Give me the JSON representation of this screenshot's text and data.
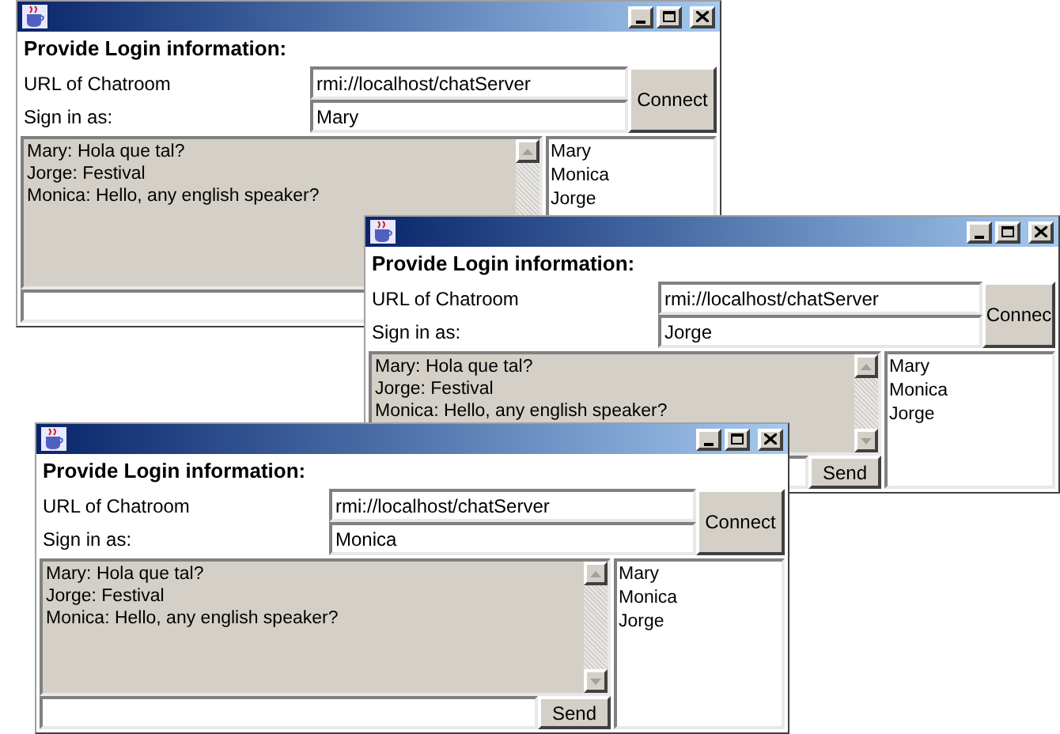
{
  "windows": [
    {
      "heading": "Provide Login information:",
      "url_label": "URL of Chatroom",
      "url_value": "rmi://localhost/chatServer",
      "name_label": "Sign in as:",
      "name_value": "Mary",
      "connect_label": "Connect",
      "messages": [
        "Mary: Hola que tal?",
        "Jorge: Festival",
        "Monica: Hello, any english speaker?"
      ],
      "users": [
        "Mary",
        "Monica",
        "Jorge"
      ]
    },
    {
      "heading": "Provide Login information:",
      "url_label": "URL of Chatroom",
      "url_value": "rmi://localhost/chatServer",
      "name_label": "Sign in as:",
      "name_value": "Jorge",
      "connect_label": "Connec",
      "messages": [
        "Mary: Hola que tal?",
        "Jorge: Festival",
        "Monica: Hello, any english speaker?"
      ],
      "users": [
        "Mary",
        "Monica",
        "Jorge"
      ],
      "send_label": "Send"
    },
    {
      "heading": "Provide Login information:",
      "url_label": "URL of Chatroom",
      "url_value": "rmi://localhost/chatServer",
      "name_label": "Sign in as:",
      "name_value": "Monica",
      "connect_label": "Connect",
      "messages": [
        "Mary: Hola que tal?",
        "Jorge: Festival",
        "Monica: Hello, any english speaker?"
      ],
      "users": [
        "Mary",
        "Monica",
        "Jorge"
      ],
      "send_label": "Send"
    }
  ]
}
